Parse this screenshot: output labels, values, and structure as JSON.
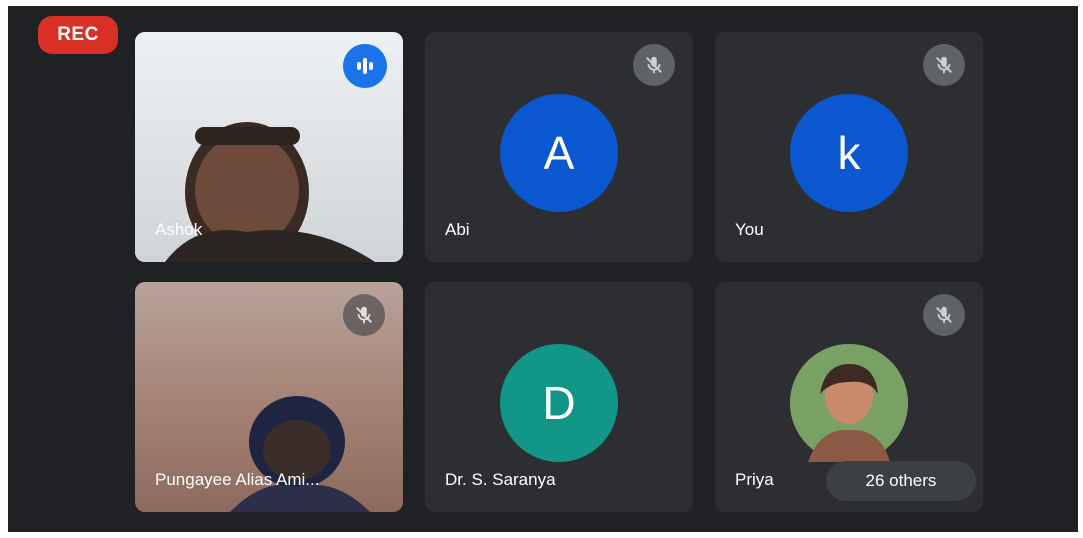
{
  "recording": {
    "label": "REC"
  },
  "participants": [
    {
      "name": "Ashok",
      "type": "video",
      "speaking": true
    },
    {
      "name": "Abi",
      "type": "avatar",
      "initial": "A",
      "avatar_color": "#0b57d0",
      "muted": true
    },
    {
      "name": "You",
      "type": "avatar",
      "initial": "k",
      "avatar_color": "#0b57d0",
      "muted": true
    },
    {
      "name": "Pungayee  Alias Ami...",
      "type": "video",
      "muted": true
    },
    {
      "name": "Dr. S. Saranya",
      "type": "avatar",
      "initial": "D",
      "avatar_color": "#129688",
      "muted": false
    },
    {
      "name": "Priya",
      "type": "photo",
      "muted": true
    }
  ],
  "others": {
    "label": "26 others"
  }
}
